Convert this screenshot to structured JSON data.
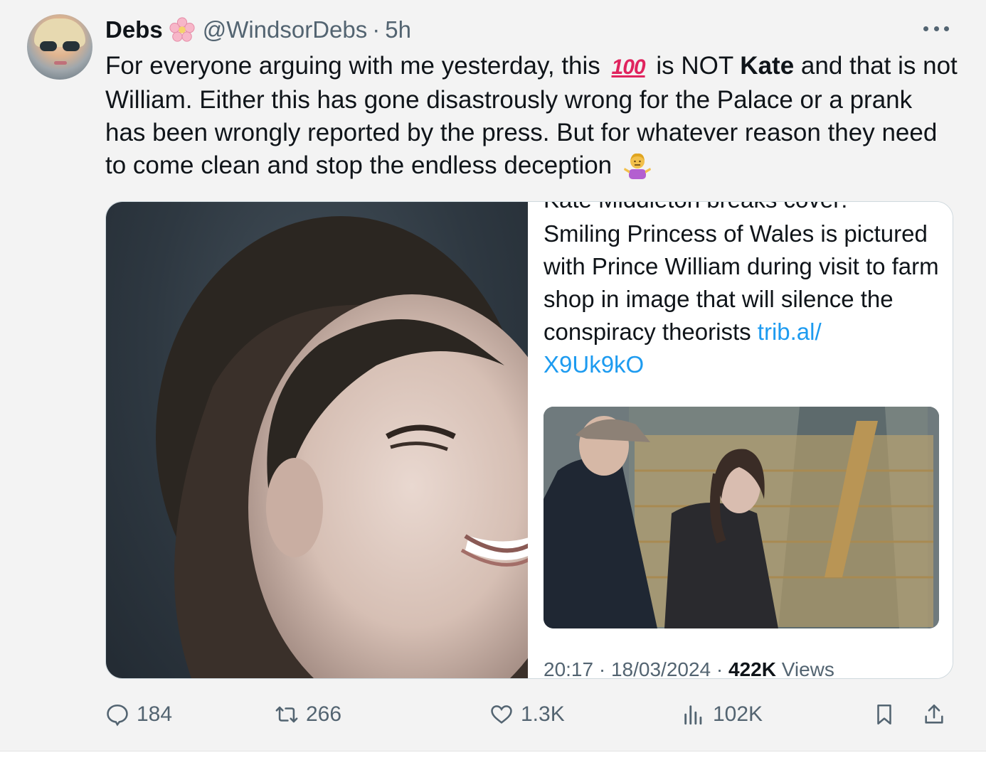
{
  "tweet": {
    "display_name": "Debs",
    "badge_icon": "cherry-blossom-icon",
    "handle": "@WindsorDebs",
    "separator": "·",
    "time": "5h",
    "text_part1": "For everyone arguing with me yesterday, this",
    "emoji_100": "100",
    "text_part2": "is NOT",
    "text_bold": "Kate",
    "text_part3": "and that is not William. Either this has gone disastrously wrong for the Palace or a prank has been wrongly reported by the press. But for whatever reason they need to come clean and stop the endless deception",
    "end_emoji": "person-shrugging-icon"
  },
  "media": {
    "quoted": {
      "cut_headline": "Kate Middleton breaks cover:",
      "text": "Smiling Princess of Wales is pictured with Prince William during visit to farm shop in image that will silence the conspiracy theorists",
      "link": "trib.al/\nX9Uk9kO",
      "time": "20:17",
      "date": "18/03/2024",
      "views_count": "422K",
      "views_label": "Views"
    }
  },
  "actions": {
    "replies": "184",
    "reposts": "266",
    "likes": "1.3K",
    "views": "102K"
  },
  "colors": {
    "background": "#f3f3f3",
    "text": "#0f1419",
    "secondary": "#536471",
    "link": "#1d9bf0"
  }
}
